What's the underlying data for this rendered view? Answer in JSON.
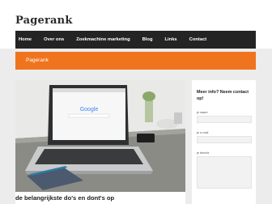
{
  "site": {
    "title": "Pagerank"
  },
  "nav": {
    "items": [
      "Home",
      "Over ons",
      "Zoekmachine marketing",
      "Blog",
      "Links",
      "Contact"
    ]
  },
  "banner": {
    "title": "Pagerank"
  },
  "post": {
    "title": "de belangrijkste do's en dont's op",
    "image_icon": "laptop-photo",
    "laptop_screen_logo": "Google"
  },
  "sidebar": {
    "title": "Meer info? Neem contact op!",
    "fields": [
      {
        "label": "je naam"
      },
      {
        "label": "je e-mail"
      },
      {
        "label": "je bericht"
      }
    ]
  },
  "colors": {
    "accent": "#f0741e",
    "nav_bg": "#242424",
    "page_bg": "#ececec"
  }
}
